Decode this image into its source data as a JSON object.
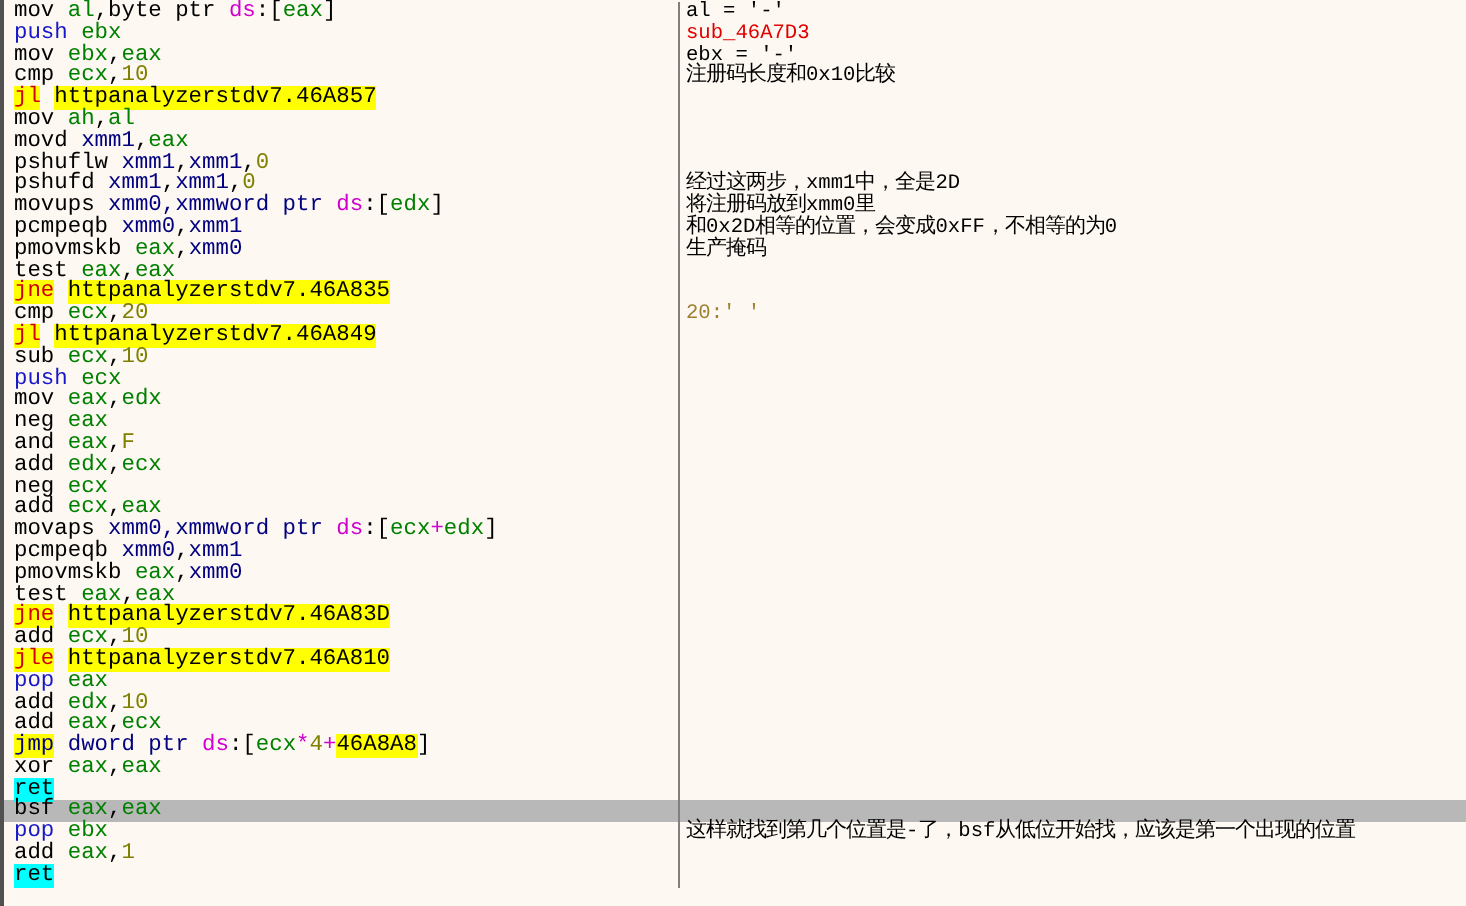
{
  "rows": [
    {
      "op": "mov",
      "kind": "op",
      "args": [
        {
          "text": "al",
          "kind": "reg"
        },
        {
          "text": ",byte ptr ",
          "kind": "plain"
        },
        {
          "text": "ds",
          "kind": "seg"
        },
        {
          "text": ":[",
          "kind": "plain"
        },
        {
          "text": "eax",
          "kind": "reg"
        },
        {
          "text": "]",
          "kind": "plain"
        }
      ],
      "comment": {
        "text": "al = '-'",
        "kind": "note"
      },
      "selected": false
    },
    {
      "op": "push",
      "kind": "stack",
      "args": [
        {
          "text": "ebx",
          "kind": "reg"
        }
      ],
      "comment": {
        "text": "sub_46A7D3",
        "kind": "label"
      },
      "selected": false
    },
    {
      "op": "mov",
      "kind": "op",
      "args": [
        {
          "text": "ebx",
          "kind": "reg"
        },
        {
          "text": ",",
          "kind": "plain"
        },
        {
          "text": "eax",
          "kind": "reg"
        }
      ],
      "comment": {
        "text": "ebx = '-'",
        "kind": "note"
      },
      "selected": false
    },
    {
      "op": "cmp",
      "kind": "op",
      "args": [
        {
          "text": "ecx",
          "kind": "reg"
        },
        {
          "text": ",",
          "kind": "plain"
        },
        {
          "text": "10",
          "kind": "num"
        }
      ],
      "comment": {
        "text": "注册码长度和0x10比较",
        "kind": "note"
      },
      "selected": false
    },
    {
      "op": "jl",
      "kind": "jump",
      "args": [
        {
          "text": "httpanalyzerstdv7.46A857",
          "kind": "target"
        }
      ],
      "selected": false
    },
    {
      "op": "mov",
      "kind": "op",
      "args": [
        {
          "text": "ah",
          "kind": "reg"
        },
        {
          "text": ",",
          "kind": "plain"
        },
        {
          "text": "al",
          "kind": "reg"
        }
      ],
      "selected": false
    },
    {
      "op": "movd",
      "kind": "op",
      "args": [
        {
          "text": "xmm1",
          "kind": "xmm"
        },
        {
          "text": ",",
          "kind": "plain"
        },
        {
          "text": "eax",
          "kind": "reg"
        }
      ],
      "selected": false
    },
    {
      "op": "pshuflw",
      "kind": "op",
      "args": [
        {
          "text": "xmm1",
          "kind": "xmm"
        },
        {
          "text": ",",
          "kind": "plain"
        },
        {
          "text": "xmm1",
          "kind": "xmm"
        },
        {
          "text": ",",
          "kind": "plain"
        },
        {
          "text": "0",
          "kind": "num"
        }
      ],
      "selected": false
    },
    {
      "op": "pshufd",
      "kind": "op",
      "args": [
        {
          "text": "xmm1",
          "kind": "xmm"
        },
        {
          "text": ",",
          "kind": "plain"
        },
        {
          "text": "xmm1",
          "kind": "xmm"
        },
        {
          "text": ",",
          "kind": "plain"
        },
        {
          "text": "0",
          "kind": "num"
        }
      ],
      "comment": {
        "text": "经过这两步，xmm1中，全是2D",
        "kind": "note"
      },
      "selected": false
    },
    {
      "op": "movups",
      "kind": "op",
      "args": [
        {
          "text": "xmm0",
          "kind": "xmm"
        },
        {
          "text": ",xmmword ptr ",
          "kind": "xmm"
        },
        {
          "text": "ds",
          "kind": "seg"
        },
        {
          "text": ":[",
          "kind": "plain"
        },
        {
          "text": "edx",
          "kind": "reg"
        },
        {
          "text": "]",
          "kind": "plain"
        }
      ],
      "comment": {
        "text": "将注册码放到xmm0里",
        "kind": "note"
      },
      "selected": false
    },
    {
      "op": "pcmpeqb",
      "kind": "op",
      "args": [
        {
          "text": "xmm0",
          "kind": "xmm"
        },
        {
          "text": ",",
          "kind": "plain"
        },
        {
          "text": "xmm1",
          "kind": "xmm"
        }
      ],
      "comment": {
        "text": "和0x2D相等的位置，会变成0xFF，不相等的为0",
        "kind": "note"
      },
      "selected": false
    },
    {
      "op": "pmovmskb",
      "kind": "op",
      "args": [
        {
          "text": "eax",
          "kind": "reg"
        },
        {
          "text": ",",
          "kind": "plain"
        },
        {
          "text": "xmm0",
          "kind": "xmm"
        }
      ],
      "comment": {
        "text": "生产掩码",
        "kind": "note"
      },
      "selected": false
    },
    {
      "op": "test",
      "kind": "op",
      "args": [
        {
          "text": "eax",
          "kind": "reg"
        },
        {
          "text": ",",
          "kind": "plain"
        },
        {
          "text": "eax",
          "kind": "reg"
        }
      ],
      "selected": false
    },
    {
      "op": "jne",
      "kind": "jump",
      "args": [
        {
          "text": "httpanalyzerstdv7.46A835",
          "kind": "target"
        }
      ],
      "selected": false
    },
    {
      "op": "cmp",
      "kind": "op",
      "args": [
        {
          "text": "ecx",
          "kind": "reg"
        },
        {
          "text": ",",
          "kind": "plain"
        },
        {
          "text": "20",
          "kind": "num"
        }
      ],
      "comment": {
        "text": "20:' '",
        "kind": "value"
      },
      "selected": false
    },
    {
      "op": "jl",
      "kind": "jump",
      "args": [
        {
          "text": "httpanalyzerstdv7.46A849",
          "kind": "target"
        }
      ],
      "selected": false
    },
    {
      "op": "sub",
      "kind": "op",
      "args": [
        {
          "text": "ecx",
          "kind": "reg"
        },
        {
          "text": ",",
          "kind": "plain"
        },
        {
          "text": "10",
          "kind": "num"
        }
      ],
      "selected": false
    },
    {
      "op": "push",
      "kind": "stack",
      "args": [
        {
          "text": "ecx",
          "kind": "reg"
        }
      ],
      "selected": false
    },
    {
      "op": "mov",
      "kind": "op",
      "args": [
        {
          "text": "eax",
          "kind": "reg"
        },
        {
          "text": ",",
          "kind": "plain"
        },
        {
          "text": "edx",
          "kind": "reg"
        }
      ],
      "selected": false
    },
    {
      "op": "neg",
      "kind": "op",
      "args": [
        {
          "text": "eax",
          "kind": "reg"
        }
      ],
      "selected": false
    },
    {
      "op": "and",
      "kind": "op",
      "args": [
        {
          "text": "eax",
          "kind": "reg"
        },
        {
          "text": ",",
          "kind": "plain"
        },
        {
          "text": "F",
          "kind": "num"
        }
      ],
      "selected": false
    },
    {
      "op": "add",
      "kind": "op",
      "args": [
        {
          "text": "edx",
          "kind": "reg"
        },
        {
          "text": ",",
          "kind": "plain"
        },
        {
          "text": "ecx",
          "kind": "reg"
        }
      ],
      "selected": false
    },
    {
      "op": "neg",
      "kind": "op",
      "args": [
        {
          "text": "ecx",
          "kind": "reg"
        }
      ],
      "selected": false
    },
    {
      "op": "add",
      "kind": "op",
      "args": [
        {
          "text": "ecx",
          "kind": "reg"
        },
        {
          "text": ",",
          "kind": "plain"
        },
        {
          "text": "eax",
          "kind": "reg"
        }
      ],
      "selected": false
    },
    {
      "op": "movaps",
      "kind": "op",
      "args": [
        {
          "text": "xmm0",
          "kind": "xmm"
        },
        {
          "text": ",xmmword ptr ",
          "kind": "xmm"
        },
        {
          "text": "ds",
          "kind": "seg"
        },
        {
          "text": ":[",
          "kind": "plain"
        },
        {
          "text": "ecx",
          "kind": "reg"
        },
        {
          "text": "+",
          "kind": "sym"
        },
        {
          "text": "edx",
          "kind": "reg"
        },
        {
          "text": "]",
          "kind": "plain"
        }
      ],
      "selected": false
    },
    {
      "op": "pcmpeqb",
      "kind": "op",
      "args": [
        {
          "text": "xmm0",
          "kind": "xmm"
        },
        {
          "text": ",",
          "kind": "plain"
        },
        {
          "text": "xmm1",
          "kind": "xmm"
        }
      ],
      "selected": false
    },
    {
      "op": "pmovmskb",
      "kind": "op",
      "args": [
        {
          "text": "eax",
          "kind": "reg"
        },
        {
          "text": ",",
          "kind": "plain"
        },
        {
          "text": "xmm0",
          "kind": "xmm"
        }
      ],
      "selected": false
    },
    {
      "op": "test",
      "kind": "op",
      "args": [
        {
          "text": "eax",
          "kind": "reg"
        },
        {
          "text": ",",
          "kind": "plain"
        },
        {
          "text": "eax",
          "kind": "reg"
        }
      ],
      "selected": false
    },
    {
      "op": "jne",
      "kind": "jump",
      "args": [
        {
          "text": "httpanalyzerstdv7.46A83D",
          "kind": "target"
        }
      ],
      "selected": false
    },
    {
      "op": "add",
      "kind": "op",
      "args": [
        {
          "text": "ecx",
          "kind": "reg"
        },
        {
          "text": ",",
          "kind": "plain"
        },
        {
          "text": "10",
          "kind": "num"
        }
      ],
      "selected": false
    },
    {
      "op": "jle",
      "kind": "jump",
      "args": [
        {
          "text": "httpanalyzerstdv7.46A810",
          "kind": "target"
        }
      ],
      "selected": false
    },
    {
      "op": "pop",
      "kind": "stack",
      "args": [
        {
          "text": "eax",
          "kind": "reg"
        }
      ],
      "selected": false
    },
    {
      "op": "add",
      "kind": "op",
      "args": [
        {
          "text": "edx",
          "kind": "reg"
        },
        {
          "text": ",",
          "kind": "plain"
        },
        {
          "text": "10",
          "kind": "num"
        }
      ],
      "selected": false
    },
    {
      "op": "add",
      "kind": "op",
      "args": [
        {
          "text": "eax",
          "kind": "reg"
        },
        {
          "text": ",",
          "kind": "plain"
        },
        {
          "text": "ecx",
          "kind": "reg"
        }
      ],
      "selected": false
    },
    {
      "op": "jmp",
      "kind": "jmpind",
      "args": [
        {
          "text": "dword ptr ",
          "kind": "xmm"
        },
        {
          "text": "ds",
          "kind": "seg"
        },
        {
          "text": ":[",
          "kind": "plain"
        },
        {
          "text": "ecx",
          "kind": "reg"
        },
        {
          "text": "*",
          "kind": "sym"
        },
        {
          "text": "4",
          "kind": "num"
        },
        {
          "text": "+",
          "kind": "sym"
        },
        {
          "text": "46A8A8",
          "kind": "target"
        },
        {
          "text": "]",
          "kind": "plain"
        }
      ],
      "selected": false
    },
    {
      "op": "xor",
      "kind": "op",
      "args": [
        {
          "text": "eax",
          "kind": "reg"
        },
        {
          "text": ",",
          "kind": "plain"
        },
        {
          "text": "eax",
          "kind": "reg"
        }
      ],
      "selected": false
    },
    {
      "op": "ret",
      "kind": "ret",
      "args": [],
      "selected": false
    },
    {
      "op": "bsf",
      "kind": "op",
      "args": [
        {
          "text": "eax",
          "kind": "reg"
        },
        {
          "text": ",",
          "kind": "plain"
        },
        {
          "text": "eax",
          "kind": "reg"
        }
      ],
      "selected": true
    },
    {
      "op": "pop",
      "kind": "stack",
      "args": [
        {
          "text": "ebx",
          "kind": "reg"
        }
      ],
      "comment": {
        "text": "这样就找到第几个位置是-了，bsf从低位开始找，应该是第一个出现的位置",
        "kind": "note"
      },
      "selected": false
    },
    {
      "op": "add",
      "kind": "op",
      "args": [
        {
          "text": "eax",
          "kind": "reg"
        },
        {
          "text": ",",
          "kind": "plain"
        },
        {
          "text": "1",
          "kind": "num"
        }
      ],
      "selected": false
    },
    {
      "op": "ret",
      "kind": "ret",
      "args": [],
      "selected": false
    }
  ]
}
